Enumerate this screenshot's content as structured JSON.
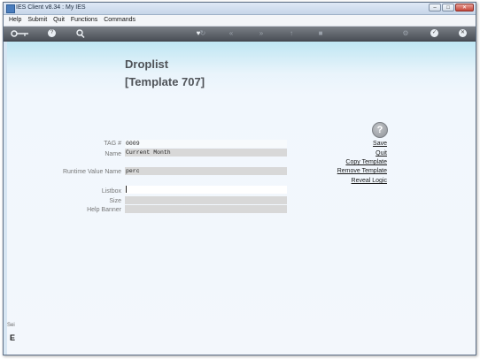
{
  "window": {
    "title": "IES Client v8.34 : My IES"
  },
  "menu": {
    "items": [
      "Help",
      "Submit",
      "Quit",
      "Functions",
      "Commands"
    ]
  },
  "toolbar": {
    "icons": [
      "key-icon",
      "help-icon",
      "search-icon",
      "heart-icon",
      "refresh-icon",
      "rewind-icon",
      "forward-icon",
      "up-icon",
      "stop-icon",
      "settings-icon",
      "check-icon",
      "close-icon"
    ]
  },
  "page": {
    "title": "Droplist",
    "subtitle": "[Template 707]"
  },
  "form": {
    "tag_label": "TAG #",
    "tag_value": "0009",
    "name_label": "Name",
    "name_value": "Current Month",
    "runtime_label": "Runtime Value Name",
    "runtime_value": "perc",
    "listbox_label": "Listbox",
    "listbox_value": "",
    "size_label": "Size",
    "size_value": "",
    "banner_label": "Help Banner",
    "banner_value": ""
  },
  "actions": {
    "help_glyph": "?",
    "save": "Save",
    "quit": "Quit",
    "copy": "Copy Template",
    "remove": "Remove Template",
    "reveal": "Reveal Logic"
  },
  "side": {
    "label": "Sei",
    "marker": "E"
  }
}
